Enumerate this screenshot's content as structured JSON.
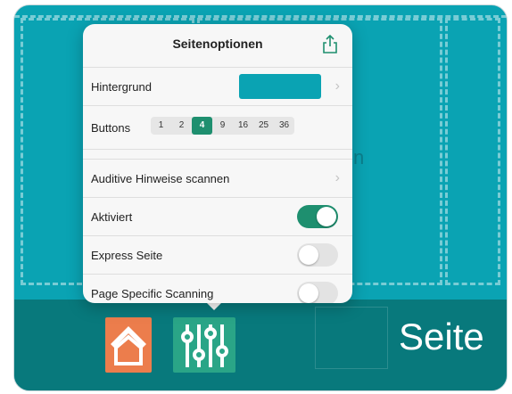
{
  "popover": {
    "title": "Seitenoptionen",
    "share_icon": "share-icon",
    "rows": {
      "background": {
        "label": "Hintergrund",
        "color": "#0aa3b3"
      },
      "buttons": {
        "label": "Buttons",
        "options": [
          "1",
          "2",
          "4",
          "9",
          "16",
          "25",
          "36"
        ],
        "selected": "4"
      },
      "audio_hints": {
        "label": "Auditive Hinweise scannen"
      },
      "activated": {
        "label": "Aktiviert",
        "on": true
      },
      "express": {
        "label": "Express Seite",
        "on": false
      },
      "page_scanning": {
        "label": "Page Specific Scanning",
        "on": false
      }
    }
  },
  "background_page": {
    "accent": "#0aa3b3",
    "bottom_bar_color": "#08797c",
    "home_button_color": "#ec7d4c",
    "options_button_color": "#2aa587",
    "bg_letter": "n",
    "page_label": "Seite"
  }
}
